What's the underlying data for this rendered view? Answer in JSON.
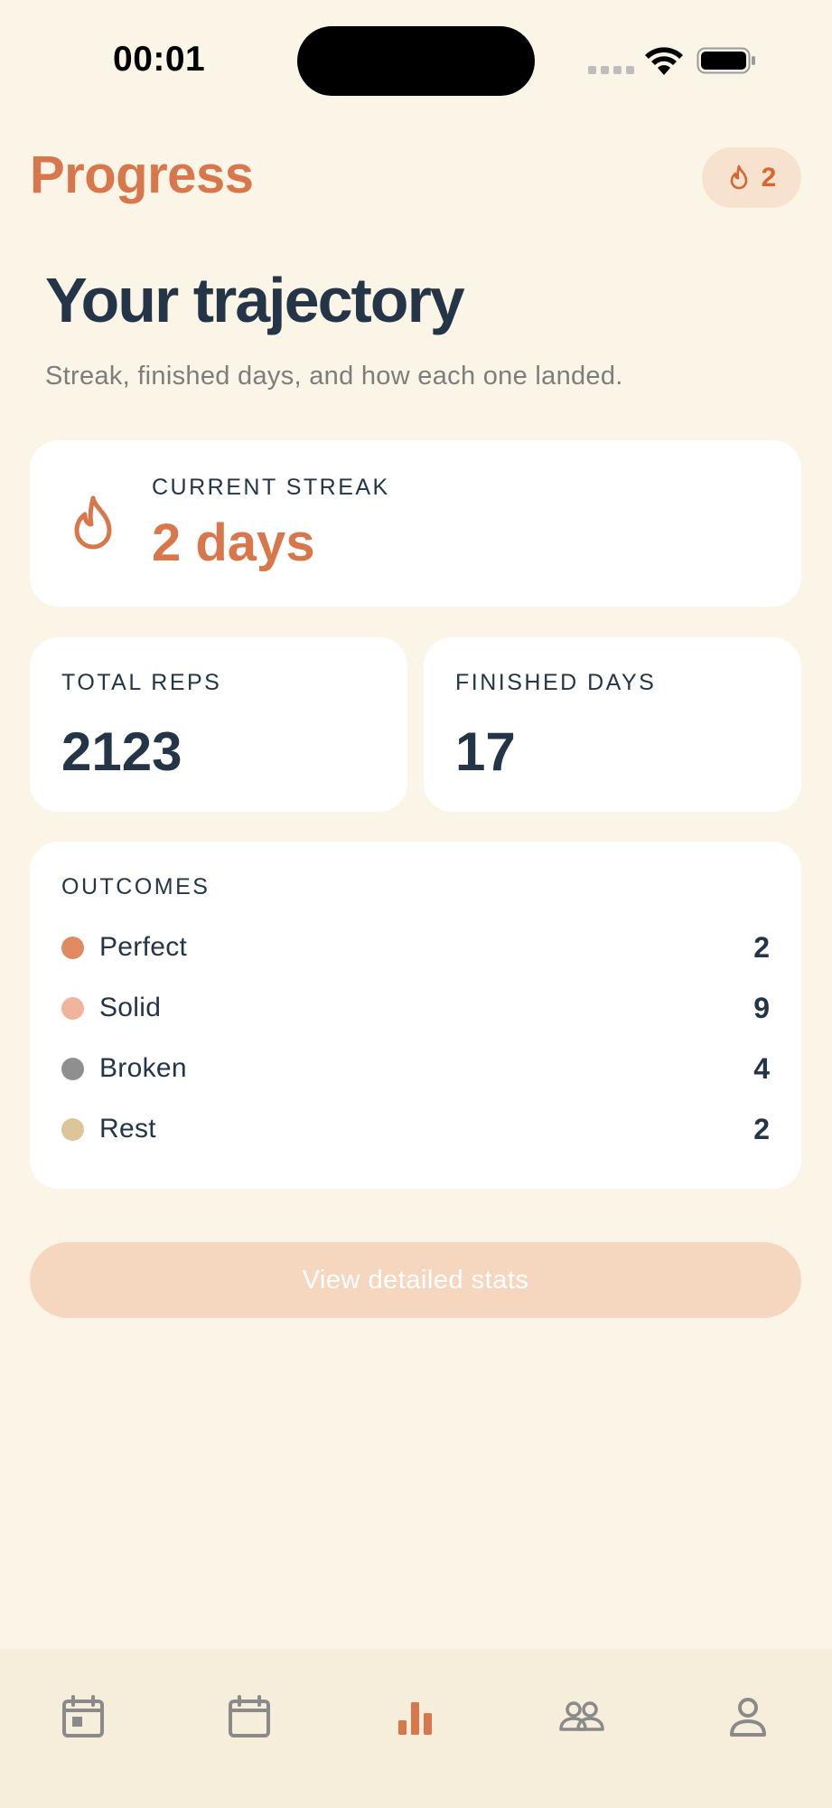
{
  "status_bar": {
    "time": "00:01"
  },
  "header": {
    "title": "Progress",
    "streak_chip_count": "2"
  },
  "hero": {
    "title": "Your trajectory",
    "subtitle": "Streak, finished days, and how each one landed."
  },
  "streak_card": {
    "label": "CURRENT STREAK",
    "value": "2 days"
  },
  "stats": {
    "total_reps": {
      "label": "TOTAL REPS",
      "value": "2123"
    },
    "finished_days": {
      "label": "FINISHED DAYS",
      "value": "17"
    }
  },
  "outcomes": {
    "label": "OUTCOMES",
    "items": [
      {
        "name": "Perfect",
        "count": "2",
        "color": "#e08a62"
      },
      {
        "name": "Solid",
        "count": "9",
        "color": "#efb59c"
      },
      {
        "name": "Broken",
        "count": "4",
        "color": "#8f8f8f"
      },
      {
        "name": "Rest",
        "count": "2",
        "color": "#dcc598"
      }
    ]
  },
  "cta": {
    "label": "View detailed stats"
  },
  "tab_bar": {
    "active_color": "#d8774b",
    "inactive_color": "#8a8a8a",
    "tabs": [
      {
        "icon": "calendar-day-icon",
        "active": false
      },
      {
        "icon": "calendar-icon",
        "active": false
      },
      {
        "icon": "bar-chart-icon",
        "active": true
      },
      {
        "icon": "people-icon",
        "active": false
      },
      {
        "icon": "person-icon",
        "active": false
      }
    ]
  },
  "colors": {
    "background": "#fbf5e7",
    "accent": "#d8774b",
    "text": "#243547",
    "muted": "#7d7d7d"
  }
}
